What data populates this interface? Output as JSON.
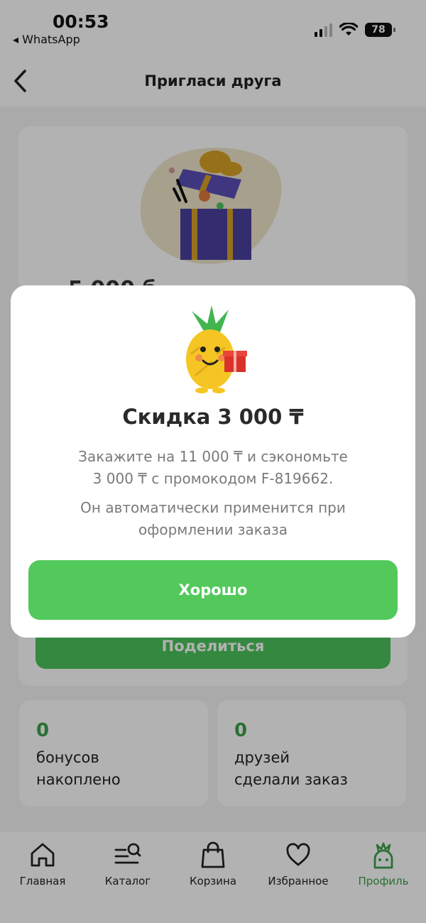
{
  "status_bar": {
    "time": "00:53",
    "back_app": "◂ WhatsApp",
    "battery": "78"
  },
  "header": {
    "title": "Пригласи друга"
  },
  "card": {
    "partial_text": "5 000 б",
    "share_label": "Поделиться"
  },
  "stats": [
    {
      "value": "0",
      "label": "бонусов\nнакоплено"
    },
    {
      "value": "0",
      "label": "друзей\nсделали заказ"
    }
  ],
  "modal": {
    "title": "Скидка 3 000 ₸",
    "line1": "Закажите на 11 000 ₸ и сэкономьте",
    "line2": "3 000 ₸ с промокодом F-819662.",
    "line3": "Он автоматически применится при",
    "line4": "оформлении заказа",
    "ok_label": "Хорошо"
  },
  "tabs": [
    {
      "label": "Главная",
      "icon": "home-icon"
    },
    {
      "label": "Каталог",
      "icon": "catalog-search-icon"
    },
    {
      "label": "Корзина",
      "icon": "bag-icon"
    },
    {
      "label": "Избранное",
      "icon": "heart-icon"
    },
    {
      "label": "Профиль",
      "icon": "pineapple-profile-icon",
      "active": true
    }
  ],
  "colors": {
    "accent": "#53c95b",
    "accent_text": "#3aa14a"
  }
}
